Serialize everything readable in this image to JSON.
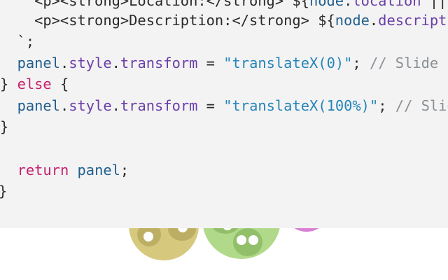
{
  "colors": {
    "panelBg": "#f3f3f3",
    "var": "#215f8e",
    "prop": "#6a3ea8",
    "string": "#2585b8",
    "keyword": "#c61f6f",
    "comment": "#8a8f95",
    "yellow": "#d6c97e",
    "yellowDark": "#bcaf64",
    "green": "#b1d98a",
    "greenDark": "#92c06a",
    "pink": "#da7fd5"
  },
  "code": {
    "line1": {
      "a": "    <p><strong>Location:</strong> ${",
      "b": "node",
      "c": ".",
      "d": "location",
      "e": " ||"
    },
    "line2": {
      "a": "    <p><strong>Description:</strong> ${",
      "b": "node",
      "c": ".",
      "d": "descripti"
    },
    "line3": {
      "a": "  `;"
    },
    "line4": {
      "a": "  ",
      "b": "panel",
      "c": ".",
      "d": "style",
      "e": ".",
      "f": "transform",
      "g": " = ",
      "h": "\"translateX(0)\"",
      "i": "; ",
      "j": "// Slide i"
    },
    "line5": {
      "a": "} ",
      "b": "else",
      "c": " {"
    },
    "line6": {
      "a": "  ",
      "b": "panel",
      "c": ".",
      "d": "style",
      "e": ".",
      "f": "transform",
      "g": " = ",
      "h": "\"translateX(100%)\"",
      "i": "; ",
      "j": "// Slid"
    },
    "line7": {
      "a": "}"
    },
    "line9": {
      "a": "return",
      "b": " ",
      "c": "panel",
      "d": ";"
    },
    "line10": {
      "a": "}"
    }
  }
}
